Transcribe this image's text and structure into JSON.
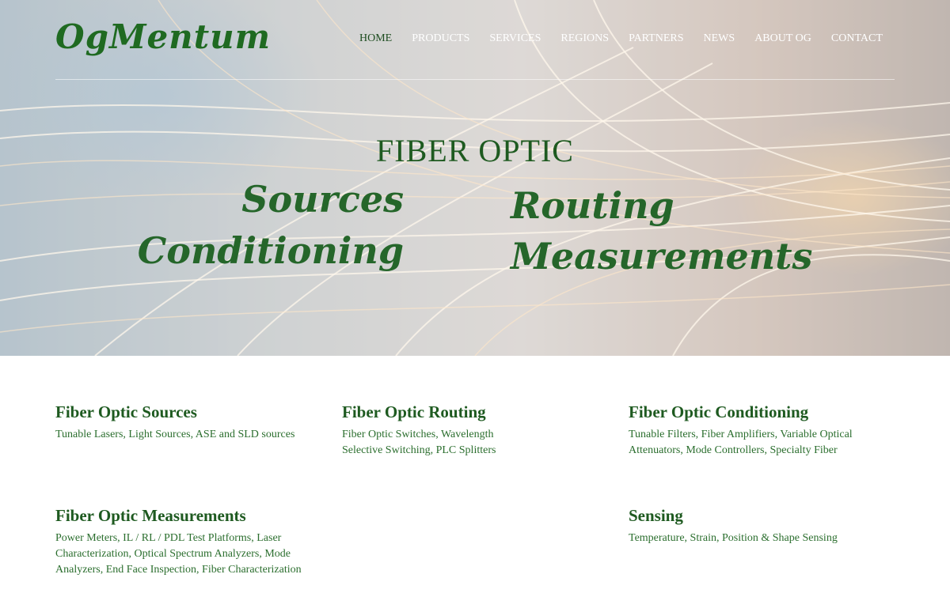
{
  "brand": {
    "logo_text": "OgMentum",
    "accent": "#1e5a20",
    "text_green": "#2b6e2e"
  },
  "nav": {
    "items": [
      {
        "label": "HOME",
        "active": true
      },
      {
        "label": "PRODUCTS"
      },
      {
        "label": "SERVICES"
      },
      {
        "label": "REGIONS"
      },
      {
        "label": "PARTNERS"
      },
      {
        "label": "NEWS"
      },
      {
        "label": "ABOUT OG"
      },
      {
        "label": "CONTACT"
      }
    ]
  },
  "hero": {
    "title": "FIBER OPTIC",
    "words": [
      "Sources",
      "Routing",
      "Conditioning",
      "Measurements"
    ]
  },
  "sections": [
    {
      "title": "Fiber Optic Sources",
      "body": "Tunable Lasers, Light Sources, ASE and SLD sources"
    },
    {
      "title": "Fiber Optic Routing",
      "body": "Fiber Optic Switches, Wavelength Selective Switching, PLC Splitters"
    },
    {
      "title": "Fiber Optic Conditioning",
      "body": "Tunable Filters, Fiber Amplifiers, Variable Optical Attenuators, Mode Controllers, Specialty Fiber"
    },
    {
      "title": "Fiber Optic Measurements",
      "body": "Power Meters, IL / RL / PDL Test Platforms, Laser Characterization, Optical Spectrum Analyzers, Mode Analyzers, End Face Inspection, Fiber Characterization"
    },
    {
      "title": "Sensing",
      "body": "Temperature, Strain, Position & Shape Sensing"
    }
  ]
}
